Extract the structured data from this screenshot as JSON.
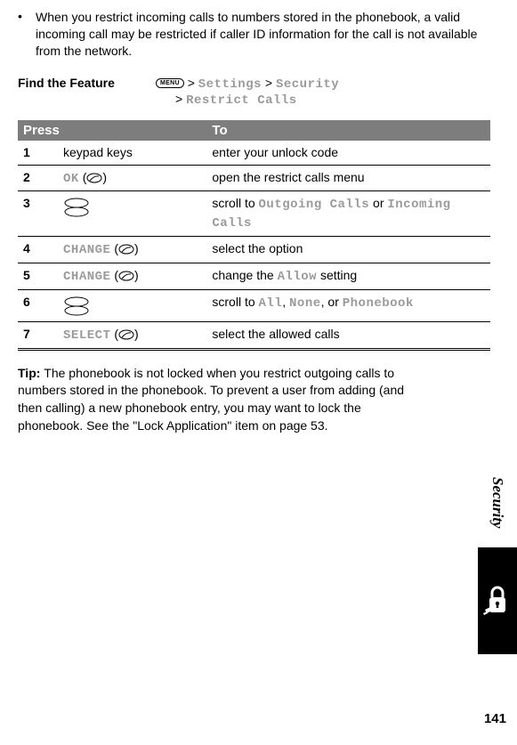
{
  "bullet": {
    "dot": "•",
    "text": "When you restrict incoming calls to numbers stored in the phonebook, a valid incoming call may be restricted if caller ID information for the call is not available from the network."
  },
  "findFeature": {
    "label": "Find the Feature",
    "menuKey": "MENU",
    "sep": ">",
    "p1": "Settings",
    "p2": "Security",
    "p3": "Restrict Calls"
  },
  "table": {
    "head": {
      "press": "Press",
      "to": "To"
    },
    "rows": [
      {
        "n": "1",
        "press_plain": "keypad keys",
        "to_plain": "enter your unlock code"
      },
      {
        "n": "2",
        "press_gray": "OK",
        "press_soft": true,
        "to_plain": "open the restrict calls menu"
      },
      {
        "n": "3",
        "press_scroll": true,
        "to_pre": "scroll to ",
        "to_g1": "Outgoing Calls",
        "to_mid": " or ",
        "to_g2": "Incoming Calls"
      },
      {
        "n": "4",
        "press_gray": "CHANGE",
        "press_soft": true,
        "to_plain": "select the option"
      },
      {
        "n": "5",
        "press_gray": "CHANGE",
        "press_soft": true,
        "to_pre": "change the ",
        "to_g1": "Allow",
        "to_post": " setting"
      },
      {
        "n": "6",
        "press_scroll": true,
        "to_pre": "scroll to ",
        "to_g1": "All",
        "to_mid1": ", ",
        "to_g2": "None",
        "to_mid2": ", or ",
        "to_g3": "Phonebook"
      },
      {
        "n": "7",
        "press_gray": "SELECT",
        "press_soft": true,
        "to_plain": "select the allowed calls"
      }
    ]
  },
  "tip": {
    "label": "Tip: ",
    "text": "The phonebook is not locked when you restrict outgoing calls to numbers stored in the phonebook. To prevent a user from adding (and then calling) a new phonebook entry, you may want to lock the phonebook. See the \"Lock Application\" item on page 53."
  },
  "side": {
    "label": "Security"
  },
  "pageNumber": "141"
}
